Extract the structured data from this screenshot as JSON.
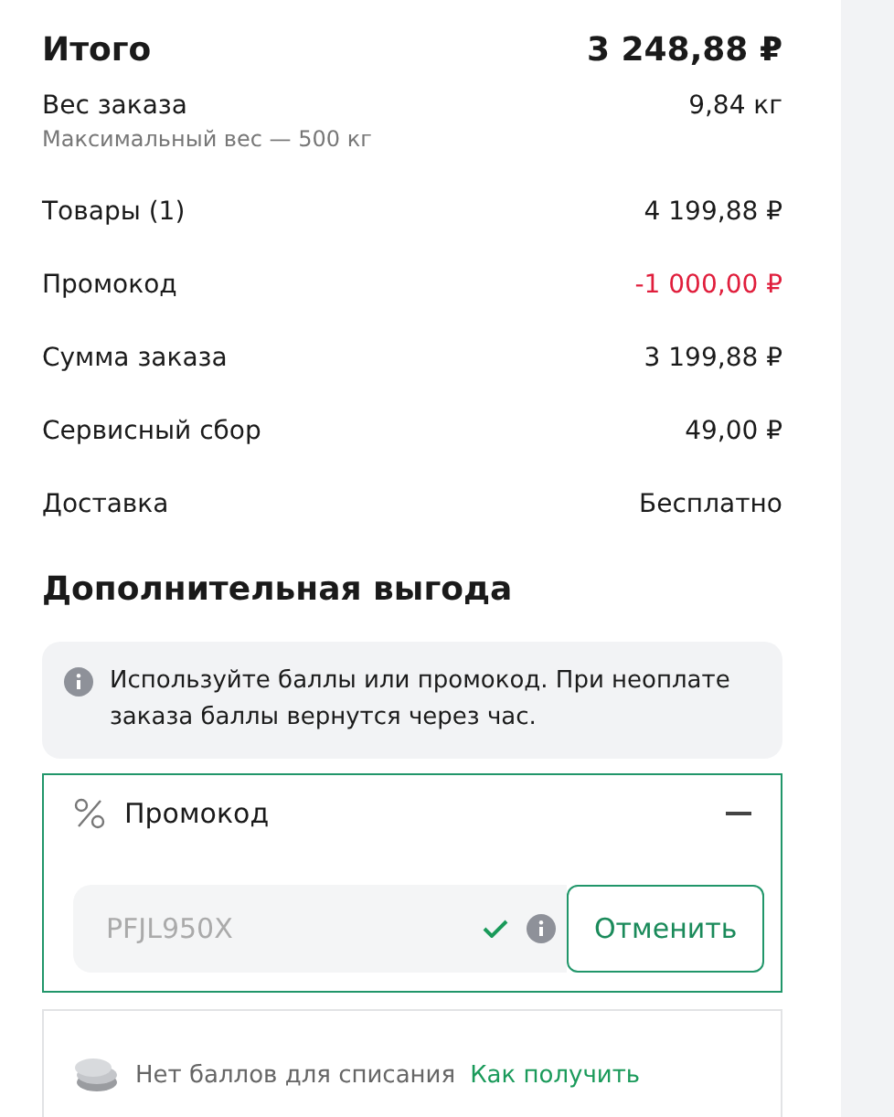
{
  "total": {
    "label": "Итого",
    "value": "3 248,88 ₽"
  },
  "rows": [
    {
      "kind": "normal",
      "label": "Вес заказа",
      "note": "Максимальный вес — 500 кг",
      "value": "9,84 кг"
    },
    {
      "kind": "normal",
      "label": "Товары (1)",
      "value": "4 199,88 ₽"
    },
    {
      "kind": "discount",
      "label": "Промокод",
      "value": "-1 000,00 ₽"
    },
    {
      "kind": "normal",
      "label": "Сумма заказа",
      "value": "3 199,88 ₽"
    },
    {
      "kind": "normal",
      "label": "Сервисный сбор",
      "value": "49,00 ₽"
    },
    {
      "kind": "normal",
      "label": "Доставка",
      "value": "Бесплатно"
    }
  ],
  "benefit": {
    "title": "Дополнительная выгода",
    "info": "Используйте баллы или промокод. При неоплате заказа баллы вернутся через час.",
    "promo": {
      "title": "Промокод",
      "expanded": true,
      "value": "PFJL950X",
      "disabled": true,
      "button": "Отменить"
    },
    "points": {
      "text": "Нет баллов для списания",
      "link": "Как получить"
    }
  }
}
